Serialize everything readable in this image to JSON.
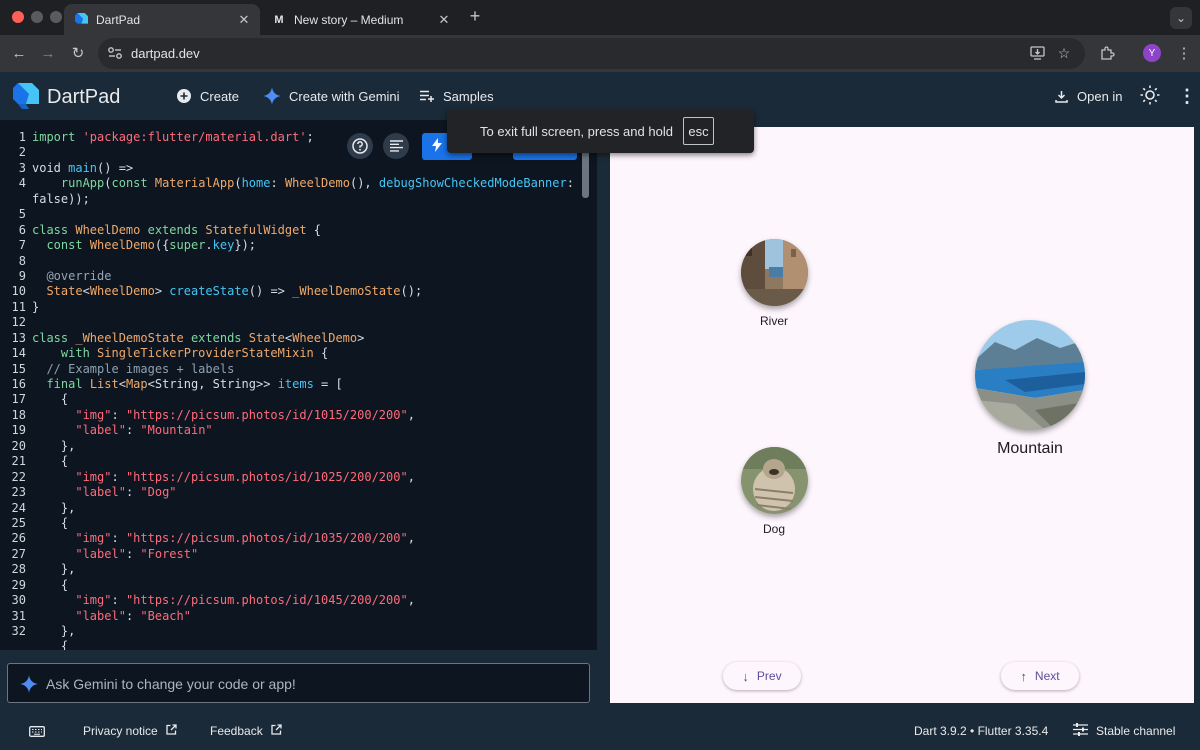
{
  "browser": {
    "tabs": [
      {
        "title": "DartPad",
        "active": true
      },
      {
        "title": "New story – Medium",
        "active": false
      }
    ],
    "url": "dartpad.dev",
    "profile_initial": "Y"
  },
  "header": {
    "title": "DartPad",
    "create_label": "Create",
    "gemini_label": "Create with Gemini",
    "samples_label": "Samples",
    "open_in_label": "Open in"
  },
  "fullscreen_toast": {
    "message": "To exit full screen, press and hold",
    "key": "esc"
  },
  "editor": {
    "lines": [
      {
        "n": "1",
        "t": [
          [
            "kw",
            "import "
          ],
          [
            "st",
            "'package:flutter/material.dart'"
          ],
          [
            "lc",
            ";"
          ]
        ]
      },
      {
        "n": "2",
        "t": []
      },
      {
        "n": "3",
        "t": [
          [
            "lc",
            "void "
          ],
          [
            "fn",
            "main"
          ],
          [
            "lc",
            "() =>"
          ]
        ]
      },
      {
        "n": "4",
        "t": [
          [
            "lc",
            "    "
          ],
          [
            "kw",
            "runApp"
          ],
          [
            "lc",
            "("
          ],
          [
            "kw",
            "const "
          ],
          [
            "ty",
            "MaterialApp"
          ],
          [
            "lc",
            "("
          ],
          [
            "fn",
            "home"
          ],
          [
            "lc",
            ": "
          ],
          [
            "ty",
            "WheelDemo"
          ],
          [
            "lc",
            "(), "
          ],
          [
            "fn",
            "debugShowCheckedModeBanner"
          ],
          [
            "lc",
            ":"
          ]
        ]
      },
      {
        "n": "",
        "t": [
          [
            "lc",
            "false));"
          ]
        ]
      },
      {
        "n": "5",
        "t": []
      },
      {
        "n": "6",
        "t": [
          [
            "kw",
            "class "
          ],
          [
            "ty",
            "WheelDemo "
          ],
          [
            "kw",
            "extends "
          ],
          [
            "ty",
            "StatefulWidget "
          ],
          [
            "lc",
            "{"
          ]
        ]
      },
      {
        "n": "7",
        "t": [
          [
            "lc",
            "  "
          ],
          [
            "kw",
            "const "
          ],
          [
            "ty",
            "WheelDemo"
          ],
          [
            "lc",
            "({"
          ],
          [
            "kw",
            "super"
          ],
          [
            "lc",
            "."
          ],
          [
            "fn",
            "key"
          ],
          [
            "lc",
            "});"
          ]
        ]
      },
      {
        "n": "8",
        "t": []
      },
      {
        "n": "9",
        "t": [
          [
            "an",
            "  @override"
          ]
        ]
      },
      {
        "n": "10",
        "t": [
          [
            "lc",
            "  "
          ],
          [
            "ty",
            "State"
          ],
          [
            "lc",
            "<"
          ],
          [
            "ty",
            "WheelDemo"
          ],
          [
            "lc",
            "> "
          ],
          [
            "fn",
            "createState"
          ],
          [
            "lc",
            "() => "
          ],
          [
            "ty",
            "_WheelDemoState"
          ],
          [
            "lc",
            "();"
          ]
        ]
      },
      {
        "n": "11",
        "t": [
          [
            "lc",
            "}"
          ]
        ]
      },
      {
        "n": "12",
        "t": []
      },
      {
        "n": "13",
        "t": [
          [
            "kw",
            "class "
          ],
          [
            "ty",
            "_WheelDemoState "
          ],
          [
            "kw",
            "extends "
          ],
          [
            "ty",
            "State"
          ],
          [
            "lc",
            "<"
          ],
          [
            "ty",
            "WheelDemo"
          ],
          [
            "lc",
            ">"
          ]
        ]
      },
      {
        "n": "14",
        "t": [
          [
            "lc",
            "    "
          ],
          [
            "kw",
            "with "
          ],
          [
            "ty",
            "SingleTickerProviderStateMixin "
          ],
          [
            "lc",
            "{"
          ]
        ]
      },
      {
        "n": "15",
        "t": [
          [
            "cm",
            "  // Example images + labels"
          ]
        ]
      },
      {
        "n": "16",
        "t": [
          [
            "lc",
            "  "
          ],
          [
            "kw",
            "final "
          ],
          [
            "ty",
            "List"
          ],
          [
            "lc",
            "<"
          ],
          [
            "ty",
            "Map"
          ],
          [
            "lc",
            "<String, String>> "
          ],
          [
            "fn",
            "items"
          ],
          [
            "lc",
            " = ["
          ]
        ]
      },
      {
        "n": "17",
        "t": [
          [
            "lc",
            "    {"
          ]
        ]
      },
      {
        "n": "18",
        "t": [
          [
            "lc",
            "      "
          ],
          [
            "st",
            "\"img\""
          ],
          [
            "lc",
            ": "
          ],
          [
            "st",
            "\"https://picsum.photos/id/1015/200/200\""
          ],
          [
            "lc",
            ","
          ]
        ]
      },
      {
        "n": "19",
        "t": [
          [
            "lc",
            "      "
          ],
          [
            "st",
            "\"label\""
          ],
          [
            "lc",
            ": "
          ],
          [
            "st",
            "\"Mountain\""
          ]
        ]
      },
      {
        "n": "20",
        "t": [
          [
            "lc",
            "    },"
          ]
        ]
      },
      {
        "n": "21",
        "t": [
          [
            "lc",
            "    {"
          ]
        ]
      },
      {
        "n": "22",
        "t": [
          [
            "lc",
            "      "
          ],
          [
            "st",
            "\"img\""
          ],
          [
            "lc",
            ": "
          ],
          [
            "st",
            "\"https://picsum.photos/id/1025/200/200\""
          ],
          [
            "lc",
            ","
          ]
        ]
      },
      {
        "n": "23",
        "t": [
          [
            "lc",
            "      "
          ],
          [
            "st",
            "\"label\""
          ],
          [
            "lc",
            ": "
          ],
          [
            "st",
            "\"Dog\""
          ]
        ]
      },
      {
        "n": "24",
        "t": [
          [
            "lc",
            "    },"
          ]
        ]
      },
      {
        "n": "25",
        "t": [
          [
            "lc",
            "    {"
          ]
        ]
      },
      {
        "n": "26",
        "t": [
          [
            "lc",
            "      "
          ],
          [
            "st",
            "\"img\""
          ],
          [
            "lc",
            ": "
          ],
          [
            "st",
            "\"https://picsum.photos/id/1035/200/200\""
          ],
          [
            "lc",
            ","
          ]
        ]
      },
      {
        "n": "27",
        "t": [
          [
            "lc",
            "      "
          ],
          [
            "st",
            "\"label\""
          ],
          [
            "lc",
            ": "
          ],
          [
            "st",
            "\"Forest\""
          ]
        ]
      },
      {
        "n": "28",
        "t": [
          [
            "lc",
            "    },"
          ]
        ]
      },
      {
        "n": "29",
        "t": [
          [
            "lc",
            "    {"
          ]
        ]
      },
      {
        "n": "30",
        "t": [
          [
            "lc",
            "      "
          ],
          [
            "st",
            "\"img\""
          ],
          [
            "lc",
            ": "
          ],
          [
            "st",
            "\"https://picsum.photos/id/1045/200/200\""
          ],
          [
            "lc",
            ","
          ]
        ]
      },
      {
        "n": "31",
        "t": [
          [
            "lc",
            "      "
          ],
          [
            "st",
            "\"label\""
          ],
          [
            "lc",
            ": "
          ],
          [
            "st",
            "\"Beach\""
          ]
        ]
      },
      {
        "n": "32",
        "t": [
          [
            "lc",
            "    },"
          ]
        ]
      },
      {
        "n": "",
        "t": [
          [
            "lc",
            "    {"
          ]
        ]
      }
    ]
  },
  "prompt": {
    "placeholder": "Ask Gemini to change your code or app!"
  },
  "preview": {
    "items": [
      {
        "label": "River"
      },
      {
        "label": "Mountain"
      },
      {
        "label": "Dog"
      }
    ],
    "prev_label": "Prev",
    "next_label": "Next"
  },
  "footer": {
    "privacy_label": "Privacy notice",
    "feedback_label": "Feedback",
    "version_label": "Dart 3.9.2 • Flutter 3.35.4",
    "channel_label": "Stable channel"
  }
}
